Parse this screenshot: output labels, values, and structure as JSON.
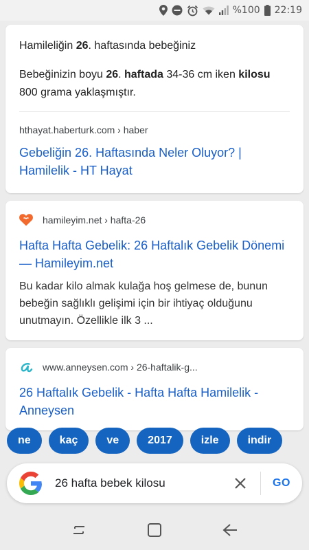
{
  "status_bar": {
    "battery_percent": "%100",
    "time": "22:19"
  },
  "featured_snippet": {
    "title_pre": "Hamileliğin ",
    "title_bold": "26",
    "title_post": ". haftasında bebeğiniz",
    "body_pre": " Bebeğinizin boyu ",
    "body_bold1": "26",
    "body_mid1": ". ",
    "body_bold2": "haftada",
    "body_mid2": " 34-36 cm iken ",
    "body_bold3": "kilosu",
    "body_post": " 800 grama yaklaşmıştır.",
    "source": "hthayat.haberturk.com › haber",
    "link": "Gebeliğin 26. Haftasında Neler Oluyor? | Hamilelik - HT Hayat"
  },
  "results": [
    {
      "source": "hamileyim.net › hafta-26",
      "favicon": "heart-icon",
      "title": "Hafta Hafta Gebelik: 26 Haftalık Gebelik Dönemi — Hamileyim.net",
      "description": "Bu kadar kilo almak kulağa hoş gelmese de, bunun bebeğin sağlıklı gelişimi için bir ihtiyaç olduğunu unutmayın. Özellikle ilk 3 ..."
    },
    {
      "source": "www.anneysen.com › 26-haftalik-g...",
      "favicon": "letter-a-icon",
      "title": "26 Haftalık Gebelik - Hafta Hafta Hamilelik - Anneysen"
    }
  ],
  "chips": [
    "ne",
    "kaç",
    "ve",
    "2017",
    "izle",
    "indir"
  ],
  "search": {
    "query": "26 hafta bebek kilosu",
    "go_label": "GO"
  },
  "colors": {
    "link": "#1a5fc7",
    "chip": "#1565c0",
    "go": "#1a73e8",
    "favicon_heart": "#f26a2e",
    "favicon_a": "#2bb5c9"
  }
}
